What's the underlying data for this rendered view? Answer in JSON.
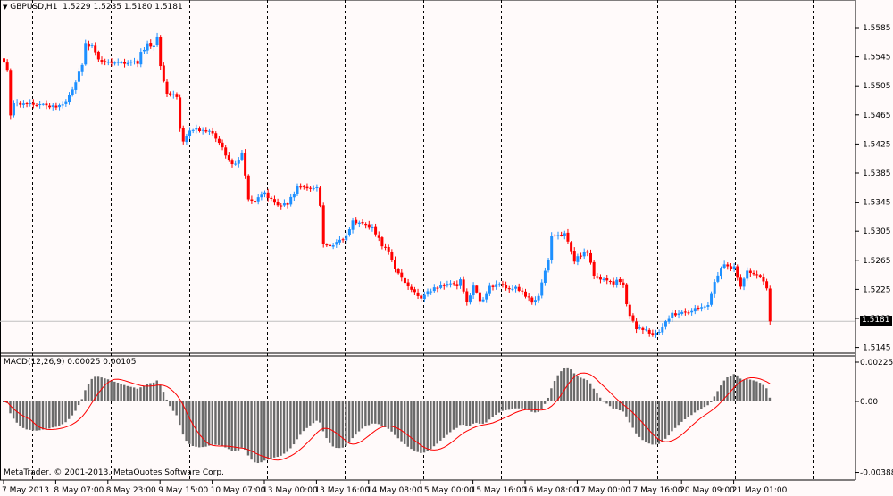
{
  "header": {
    "symbol_label": "GBPUSD,H1",
    "ohlc_label": "1.5229 1.5235 1.5180 1.5181",
    "menu_icon": "triangle-down-icon"
  },
  "indicator": {
    "label": "MACD(12,26,9) 0.00025 0.00105"
  },
  "copyright": "MetaTrader, © 2001-2013, MetaQuotes Software Corp.",
  "colors": {
    "background": "#fffafa",
    "bull": "#1e90ff",
    "bear": "#ff0000",
    "histogram": "#6a6a6a",
    "signal": "#ff0000",
    "grid": "#000000",
    "price_line": "#c0c0c0"
  },
  "chart_data": [
    {
      "type": "candlestick",
      "title": "GBPUSD,H1",
      "current_price": "1.5181",
      "ylim": [
        1.5125,
        1.5615
      ],
      "y_ticks": [
        "1.5585",
        "1.5545",
        "1.5505",
        "1.5465",
        "1.5425",
        "1.5385",
        "1.5345",
        "1.5305",
        "1.5265",
        "1.5225",
        "1.5185",
        "1.5145"
      ],
      "x_ticks": [
        "7 May 2013",
        "8 May 07:00",
        "8 May 23:00",
        "9 May 15:00",
        "10 May 07:00",
        "13 May 00:00",
        "13 May 16:00",
        "14 May 08:00",
        "15 May 00:00",
        "15 May 16:00",
        "16 May 08:00",
        "17 May 00:00",
        "17 May 16:00",
        "20 May 09:00",
        "21 May 01:00"
      ],
      "bars_per_x_tick": 16,
      "bar_count": 236,
      "close_keypoints": [
        [
          0,
          1.5537
        ],
        [
          1,
          1.5527
        ],
        [
          2,
          1.5466
        ],
        [
          3,
          1.5482
        ],
        [
          5,
          1.5479
        ],
        [
          7,
          1.5481
        ],
        [
          12,
          1.5478
        ],
        [
          16,
          1.5476
        ],
        [
          19,
          1.5482
        ],
        [
          21,
          1.55
        ],
        [
          24,
          1.5535
        ],
        [
          25,
          1.5562
        ],
        [
          27,
          1.5559
        ],
        [
          29,
          1.5543
        ],
        [
          31,
          1.5537
        ],
        [
          33,
          1.5537
        ],
        [
          38,
          1.5537
        ],
        [
          41,
          1.5537
        ],
        [
          42,
          1.555
        ],
        [
          44,
          1.5562
        ],
        [
          46,
          1.5559
        ],
        [
          47,
          1.5571
        ],
        [
          48,
          1.5531
        ],
        [
          50,
          1.5494
        ],
        [
          53,
          1.5491
        ],
        [
          54,
          1.5445
        ],
        [
          55,
          1.5427
        ],
        [
          57,
          1.5445
        ],
        [
          59,
          1.5445
        ],
        [
          64,
          1.5441
        ],
        [
          66,
          1.5427
        ],
        [
          69,
          1.5402
        ],
        [
          71,
          1.5396
        ],
        [
          73,
          1.5414
        ],
        [
          75,
          1.5347
        ],
        [
          77,
          1.5347
        ],
        [
          80,
          1.5359
        ],
        [
          81,
          1.5351
        ],
        [
          84,
          1.5341
        ],
        [
          87,
          1.5343
        ],
        [
          90,
          1.5365
        ],
        [
          92,
          1.5368
        ],
        [
          94,
          1.5363
        ],
        [
          96,
          1.5365
        ],
        [
          97,
          1.5341
        ],
        [
          98,
          1.5286
        ],
        [
          101,
          1.5286
        ],
        [
          103,
          1.5292
        ],
        [
          105,
          1.5298
        ],
        [
          107,
          1.5319
        ],
        [
          110,
          1.5314
        ],
        [
          113,
          1.531
        ],
        [
          116,
          1.5286
        ],
        [
          118,
          1.5276
        ],
        [
          120,
          1.5255
        ],
        [
          122,
          1.524
        ],
        [
          125,
          1.5224
        ],
        [
          128,
          1.5214
        ],
        [
          131,
          1.5224
        ],
        [
          133,
          1.5228
        ],
        [
          136,
          1.5233
        ],
        [
          139,
          1.523
        ],
        [
          140,
          1.5239
        ],
        [
          142,
          1.5206
        ],
        [
          143,
          1.5218
        ],
        [
          144,
          1.523
        ],
        [
          146,
          1.5208
        ],
        [
          147,
          1.5212
        ],
        [
          149,
          1.5228
        ],
        [
          152,
          1.5233
        ],
        [
          154,
          1.5227
        ],
        [
          157,
          1.5227
        ],
        [
          159,
          1.5221
        ],
        [
          162,
          1.5208
        ],
        [
          164,
          1.5216
        ],
        [
          165,
          1.5233
        ],
        [
          167,
          1.5267
        ],
        [
          168,
          1.5298
        ],
        [
          170,
          1.53
        ],
        [
          172,
          1.5301
        ],
        [
          175,
          1.5265
        ],
        [
          177,
          1.5273
        ],
        [
          179,
          1.5277
        ],
        [
          181,
          1.5243
        ],
        [
          184,
          1.5239
        ],
        [
          187,
          1.5233
        ],
        [
          188,
          1.5237
        ],
        [
          190,
          1.5233
        ],
        [
          191,
          1.5206
        ],
        [
          192,
          1.5188
        ],
        [
          194,
          1.5172
        ],
        [
          197,
          1.5169
        ],
        [
          199,
          1.5163
        ],
        [
          201,
          1.5165
        ],
        [
          202,
          1.5175
        ],
        [
          205,
          1.5191
        ],
        [
          207,
          1.5191
        ],
        [
          210,
          1.5194
        ],
        [
          213,
          1.52
        ],
        [
          216,
          1.5202
        ],
        [
          218,
          1.5237
        ],
        [
          221,
          1.5261
        ],
        [
          222,
          1.5255
        ],
        [
          224,
          1.5255
        ],
        [
          226,
          1.523
        ],
        [
          228,
          1.5249
        ],
        [
          231,
          1.5245
        ],
        [
          233,
          1.5237
        ],
        [
          234,
          1.5227
        ],
        [
          235,
          1.5181
        ]
      ]
    },
    {
      "type": "bar",
      "title": "MACD(12,26,9)",
      "main_value": "0.00025",
      "signal_value": "0.00105",
      "params": {
        "fast": 12,
        "slow": 26,
        "signal": 9
      },
      "ylim": [
        -0.00388,
        0.00225
      ],
      "y_ticks": [
        "0.00225",
        "0.00",
        "-0.00388"
      ],
      "series": [
        {
          "name": "MACD main (histogram)",
          "derived_from": "close_keypoints"
        },
        {
          "name": "Signal (line)",
          "derived_from": "close_keypoints"
        }
      ]
    }
  ]
}
